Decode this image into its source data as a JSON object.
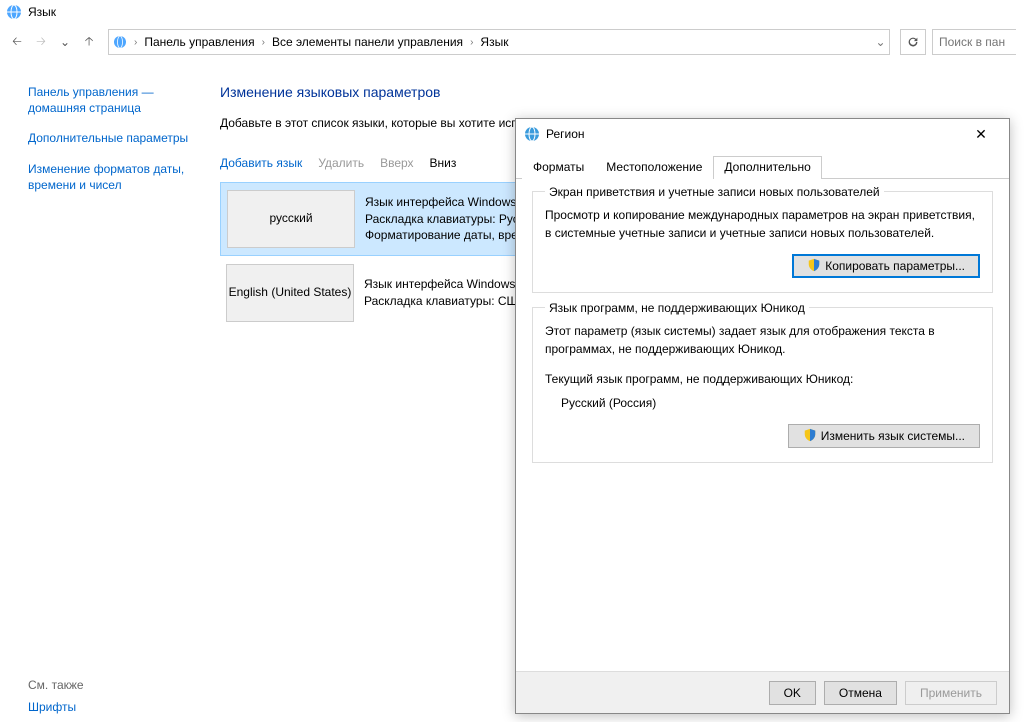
{
  "window": {
    "title": "Язык"
  },
  "nav": {
    "breadcrumb": [
      "Панель управления",
      "Все элементы панели управления",
      "Язык"
    ],
    "search_placeholder": "Поиск в пан"
  },
  "sidebar": {
    "link_home1": "Панель управления —",
    "link_home2": "домашняя страница",
    "link_adv": "Дополнительные параметры",
    "link_date1": "Изменение форматов даты,",
    "link_date2": "времени и чисел",
    "see_also": "См. также",
    "fonts": "Шрифты"
  },
  "content": {
    "heading": "Изменение языковых параметров",
    "desc": "Добавьте в этот список языки, которые вы хотите использовать (основной язык, который вы хотите видеть и чаще всего использовать).",
    "toolbar": {
      "add": "Добавить язык",
      "del": "Удалить",
      "up": "Вверх",
      "down": "Вниз"
    },
    "langs": [
      {
        "name": "русский",
        "l1": "Язык интерфейса Windows: Включен",
        "l2": "Раскладка клавиатуры: Русская",
        "l3": "Форматирование даты, времени и чисел",
        "selected": true
      },
      {
        "name": "English (United States)",
        "l1": "Язык интерфейса Windows: Доступен",
        "l2": "Раскладка клавиатуры: США",
        "l3": "",
        "selected": false
      }
    ]
  },
  "dialog": {
    "title": "Регион",
    "tabs": {
      "formats": "Форматы",
      "location": "Местоположение",
      "advanced": "Дополнительно"
    },
    "fs1": {
      "legend": "Экран приветствия и учетные записи новых пользователей",
      "text": "Просмотр и копирование международных параметров на экран приветствия, в системные учетные записи и учетные записи новых пользователей.",
      "btn": "Копировать параметры..."
    },
    "fs2": {
      "legend": "Язык программ, не поддерживающих Юникод",
      "text1": "Этот параметр (язык системы) задает язык для отображения текста в программах, не поддерживающих Юникод.",
      "text2": "Текущий язык программ, не поддерживающих Юникод:",
      "current": "Русский (Россия)",
      "btn": "Изменить язык системы..."
    },
    "footer": {
      "ok": "OK",
      "cancel": "Отмена",
      "apply": "Применить"
    }
  }
}
